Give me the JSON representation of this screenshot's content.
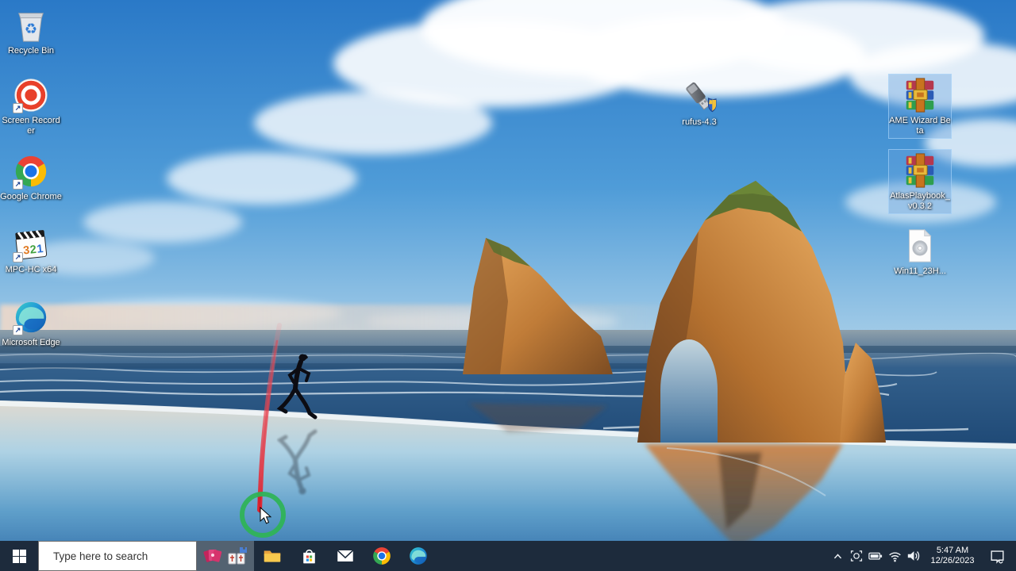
{
  "desktop": {
    "icons": [
      {
        "id": "recycle-bin",
        "label": "Recycle Bin"
      },
      {
        "id": "screen-recorder",
        "label": "Screen Recorder"
      },
      {
        "id": "google-chrome",
        "label": "Google Chrome"
      },
      {
        "id": "mpc-hc-x64",
        "label": "MPC-HC x64"
      },
      {
        "id": "microsoft-edge",
        "label": "Microsoft Edge"
      },
      {
        "id": "rufus",
        "label": "rufus-4.3"
      },
      {
        "id": "ame-wizard",
        "label": "AME Wizard Beta"
      },
      {
        "id": "atlas-playbook",
        "label": "AtlasPlaybook_v0.3.2"
      },
      {
        "id": "win11-iso",
        "label": "Win11_23H..."
      }
    ],
    "annotation": {
      "pen_stroke_color": "#e02430",
      "highlight_circle_color": "#2fb357"
    }
  },
  "taskbar": {
    "search": {
      "placeholder": "Type here to search"
    },
    "apps": [
      {
        "id": "casual-games",
        "active": true
      },
      {
        "id": "file-explorer",
        "active": false
      },
      {
        "id": "microsoft-store",
        "active": false
      },
      {
        "id": "mail",
        "active": false
      },
      {
        "id": "chrome",
        "active": false
      },
      {
        "id": "edge",
        "active": false
      }
    ],
    "tray": {
      "time": "5:47 AM",
      "date": "12/26/2023"
    },
    "colors": {
      "taskbar_bg": "#1d2b3c",
      "search_bg": "#ffffff"
    }
  }
}
